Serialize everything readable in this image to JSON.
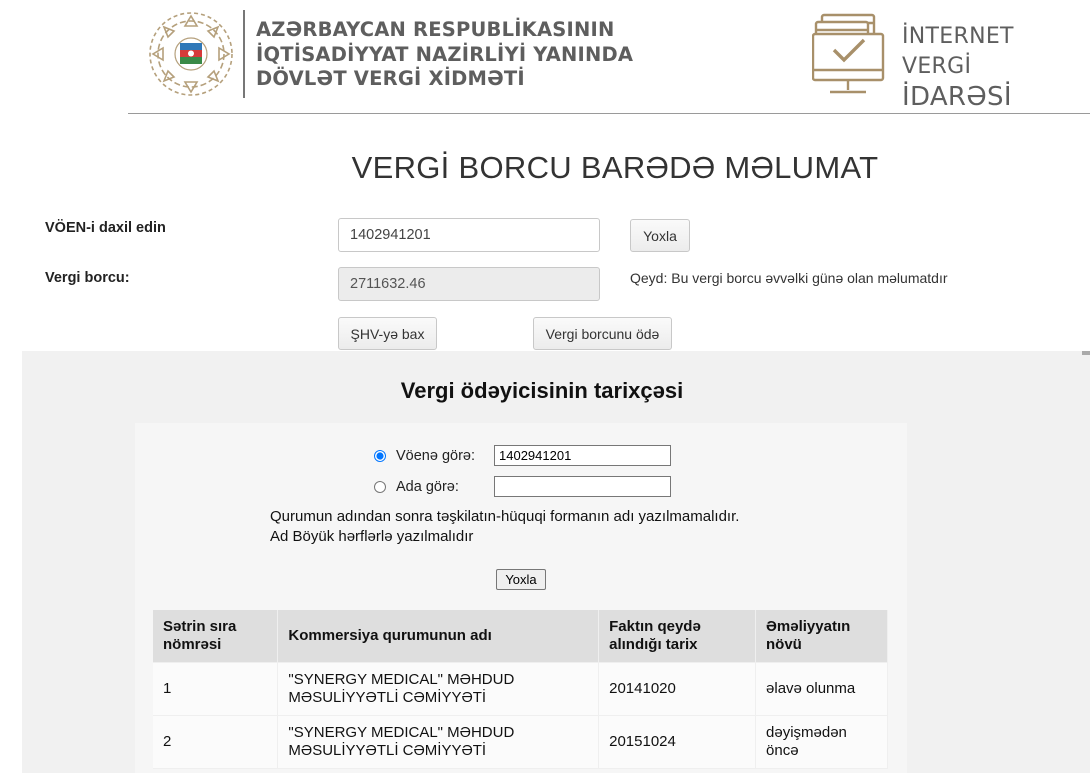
{
  "header": {
    "org_line1": "AZƏRBAYCAN RESPUBLİKASININ",
    "org_line2": "İQTİSADİYYAT NAZİRLİYİ YANINDA",
    "org_line3": "DÖVLƏT VERGİ XİDMƏTİ",
    "ivi_line1": "İNTERNET VERGİ",
    "ivi_line2": "İDARƏSİ"
  },
  "page": {
    "title": "VERGİ BORCU BARƏDƏ MƏLUMAT"
  },
  "debt_form": {
    "voen_label": "VÖEN-i daxil edin",
    "voen_value": "1402941201",
    "check_label": "Yoxla",
    "debt_label": "Vergi borcu:",
    "debt_value": "2711632.46",
    "note": "Qeyd: Bu vergi borcu əvvəlki günə olan məlumatdır",
    "shv_label": "ŞHV-yə bax",
    "pay_label": "Vergi borcunu ödə"
  },
  "history": {
    "title": "Vergi ödəyicisinin tarixçəsi",
    "by_voen_label": "Vöenə görə:",
    "by_voen_value": "1402941201",
    "by_name_label": "Ada görə:",
    "by_name_value": "",
    "info_line1": "Qurumun adından sonra təşkilatın-hüquqi formanın adı yazılmamalıdır.",
    "info_line2": "Ad Böyük hərflərlə yazılmalıdır",
    "check_label": "Yoxla"
  },
  "table": {
    "headers": [
      "Sətrin sıra nömrəsi",
      "Kommersiya qurumunun adı",
      "Faktın qeydə alındığı tarix",
      "Əməliyyatın növü"
    ],
    "rows": [
      [
        "1",
        "\"SYNERGY MEDICAL\" MƏHDUD MƏSULİYYƏTLİ CƏMİYYƏTİ",
        "20141020",
        "əlavə olunma"
      ],
      [
        "2",
        "\"SYNERGY MEDICAL\" MƏHDUD MƏSULİYYƏTLİ CƏMİYYƏTİ",
        "20151024",
        "dəyişmədən öncə"
      ]
    ]
  },
  "colors": {
    "header_text": "#5e5e5e",
    "brand_gold": "#a8906a",
    "emblem_green": "#3a8a47",
    "emblem_red": "#d63a3a",
    "emblem_blue": "#2f78b8",
    "section_bg": "#f1f1f1"
  },
  "icons": [
    "state-emblem-icon",
    "internet-tax-office-icon"
  ]
}
